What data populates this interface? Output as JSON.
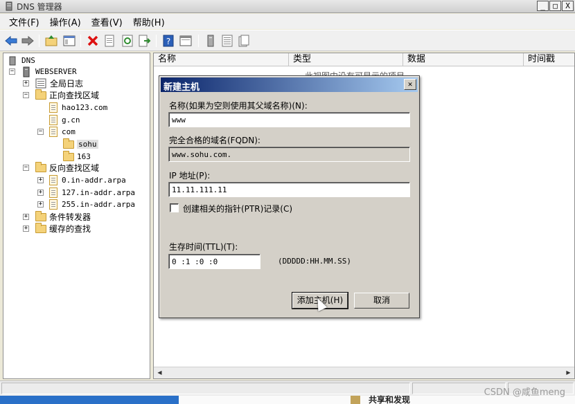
{
  "window": {
    "title": "DNS 管理器",
    "buttons": [
      "_",
      "□",
      "X"
    ]
  },
  "menu": [
    "文件(F)",
    "操作(A)",
    "查看(V)",
    "帮助(H)"
  ],
  "tree": {
    "root": "DNS",
    "server": "WEBSERVER",
    "global_log": "全局日志",
    "forward_zone": "正向查找区域",
    "forward_items": [
      "hao123.com",
      "g.cn",
      "com"
    ],
    "com_children": [
      "sohu",
      "163"
    ],
    "reverse_zone": "反向查找区域",
    "reverse_items": [
      "0.in-addr.arpa",
      "127.in-addr.arpa",
      "255.in-addr.arpa"
    ],
    "conditional": "条件转发器",
    "cached": "缓存的查找"
  },
  "list": {
    "columns": [
      "名称",
      "类型",
      "数据",
      "时间戳"
    ],
    "empty_text": "此视图中没有可显示的项目。"
  },
  "dialog": {
    "title": "新建主机",
    "name_label": "名称(如果为空则使用其父域名称)(N):",
    "name_value": "www",
    "fqdn_label": "完全合格的域名(FQDN):",
    "fqdn_value": "www.sohu.com.",
    "ip_label": "IP 地址(P):",
    "ip_value": "11.11.111.11",
    "ptr_label": "创建相关的指针(PTR)记录(C)",
    "ptr_checked": false,
    "ttl_label": "生存时间(TTL)(T):",
    "ttl_value": "0      :1  :0  :0",
    "ttl_format": "(DDDDD:HH.MM.SS)",
    "add_button": "添加主机(H)",
    "cancel_button": "取消"
  },
  "taskbar": {
    "text": "共享和发现"
  },
  "watermark": "CSDN @咸鱼meng"
}
